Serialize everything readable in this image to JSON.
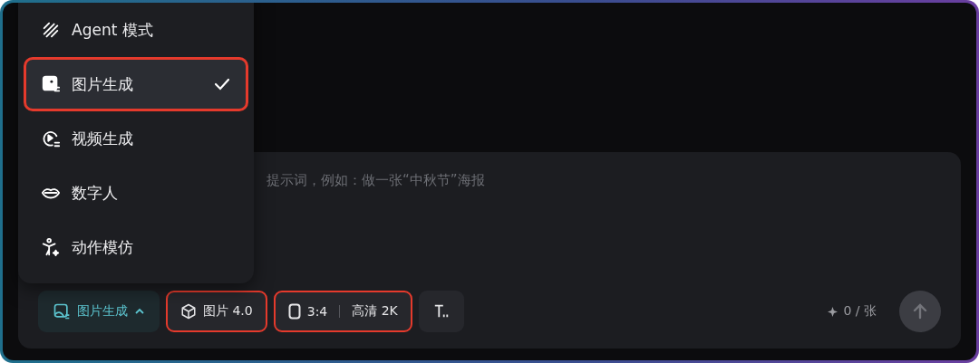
{
  "menu": {
    "items": [
      {
        "kind": "agent",
        "label": "Agent 模式",
        "selected": false,
        "highlighted": false
      },
      {
        "kind": "image",
        "label": "图片生成",
        "selected": true,
        "highlighted": true
      },
      {
        "kind": "video",
        "label": "视频生成",
        "selected": false,
        "highlighted": false
      },
      {
        "kind": "avatar",
        "label": "数字人",
        "selected": false,
        "highlighted": false
      },
      {
        "kind": "motion",
        "label": "动作模仿",
        "selected": false,
        "highlighted": false
      }
    ]
  },
  "prompt": {
    "placeholder": "提示词，例如：做一张“中秋节”海报"
  },
  "toolbar": {
    "mode": {
      "label": "图片生成",
      "expanded": true,
      "highlighted": false
    },
    "model": {
      "label": "图片 4.0",
      "highlighted": true
    },
    "ratio": {
      "ratio": "3:4",
      "quality": "高清 2K",
      "highlighted": true
    },
    "credits": "0 / 张"
  }
}
